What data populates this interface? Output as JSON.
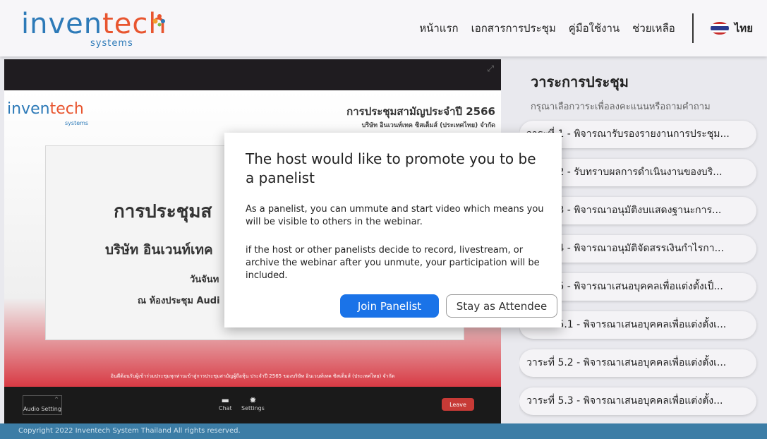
{
  "header": {
    "logo_main_a": "inven",
    "logo_main_b": "tech",
    "logo_sub": "systems",
    "nav": [
      "หน้าแรก",
      "เอกสารการประชุม",
      "คู่มือใช้งาน",
      "ช่วยเหลือ"
    ],
    "language": "ไทย"
  },
  "slide": {
    "logo_a": "inven",
    "logo_b": "tech",
    "logo_sub": "systems",
    "title": "การประชุมสามัญประจำปี 2566",
    "subtitle": "บริษัท อินเวนท์เทค ซิสเต็มส์ (ประเทศไทย) จำกัด",
    "card_line1": "การประชุมส",
    "card_line2": "บริษัท อินเวนท์เทค",
    "card_line3": "วันจันท",
    "card_line4": "ณ ห้องประชุม Audi",
    "footer": "อินดีต้อนรับผู้เข้าร่วมประชุมทุกท่านเข้าสู่การประชุมสามัญผู้ถือหุ้น ประจำปี 2565 ของบริษัท อินเวนท์เทค ซิสเต็มส์ (ประเทศไทย) จำกัด"
  },
  "controls": {
    "audio_setting": "Audio Setting",
    "chat": "Chat",
    "settings": "Settings",
    "leave": "Leave"
  },
  "agenda": {
    "title": "วาระการประชุม",
    "subtitle": "กรุณาเลือกวาระเพื่อลงคะแนนหรือถามคำถาม",
    "items": [
      "วาระที่ 1 - พิจารณารับรองรายงานการประชุม...",
      "วาระที่ 2 - รับทราบผลการดำเนินงานของบริ...",
      "วาระที่ 3 - พิจารณาอนุมัติงบแสดงฐานะการ...",
      "วาระที่ 4 - พิจารณาอนุมัติจัดสรรเงินกำไรกา...",
      "วาระที่ 5 - พิจารณาเสนอบุคคลเพื่อแต่งตั้งเป็...",
      "วาระที่ 5.1 - พิจารณาเสนอบุคคลเพื่อแต่งตั้งเ...",
      "วาระที่ 5.2 - พิจารณาเสนอบุคคลเพื่อแต่งตั้งเ...",
      "วาระที่ 5.3 - พิจารณาเสนอบุคคลเพื่อแต่งตั้ง..."
    ]
  },
  "dialog": {
    "title": "The host would like to promote you to be a panelist",
    "para1": "As a panelist, you can ummute and start video which means you will be visible to others in the webinar.",
    "para2": "if the host or other panelists decide to record, livestream, or archive the webinar after you unmute, your participation will be included.",
    "join": "Join Panelist",
    "stay": "Stay as Attendee"
  },
  "footer": {
    "copyright": "Copyright  2022 Inventech System Thailand All rights reserved."
  },
  "colors": {
    "brand_blue": "#2d7ab8",
    "brand_orange": "#e8552f",
    "primary_button": "#1a73e8",
    "leave_button": "#c73a36",
    "footer_bar": "#3c7da6"
  }
}
